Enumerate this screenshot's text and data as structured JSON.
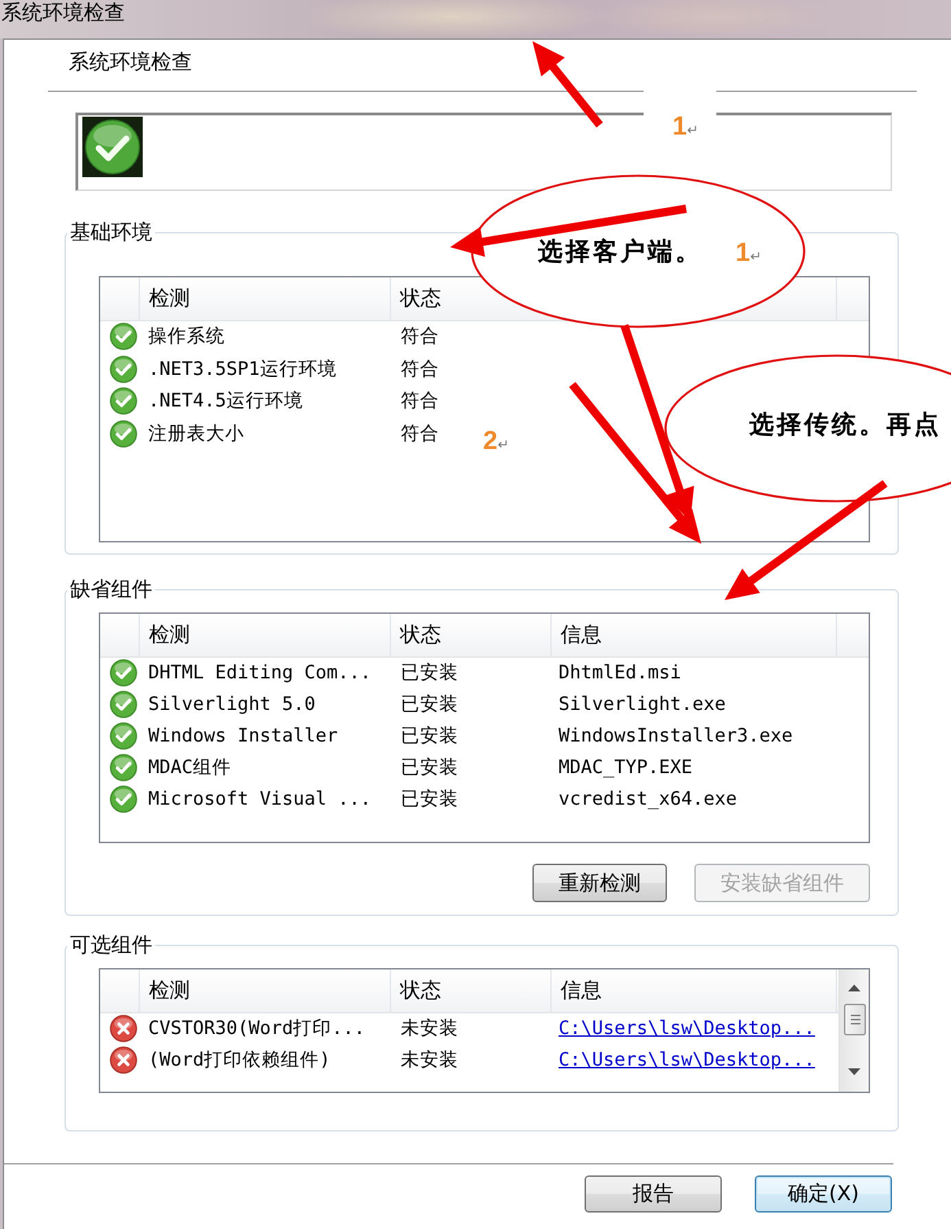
{
  "window": {
    "title": "系统环境检查"
  },
  "header": {
    "title": "系统环境检查"
  },
  "status_box": {
    "passed": true
  },
  "groups": [
    {
      "title": "基础环境",
      "columns": [
        "检测",
        "状态"
      ],
      "rows": [
        {
          "passed": true,
          "check": "操作系统",
          "status": "符合"
        },
        {
          "passed": true,
          "check": ".NET3.5SP1运行环境",
          "status": "符合"
        },
        {
          "passed": true,
          "check": ".NET4.5运行环境",
          "status": "符合"
        },
        {
          "passed": true,
          "check": "注册表大小",
          "status": "符合"
        }
      ]
    },
    {
      "title": "缺省组件",
      "columns": [
        "检测",
        "状态",
        "信息"
      ],
      "rows": [
        {
          "passed": true,
          "check": "DHTML Editing Com...",
          "status": "已安装",
          "info": "DhtmlEd.msi",
          "info_link": false
        },
        {
          "passed": true,
          "check": "Silverlight 5.0",
          "status": "已安装",
          "info": "Silverlight.exe",
          "info_link": false
        },
        {
          "passed": true,
          "check": "Windows Installer",
          "status": "已安装",
          "info": "WindowsInstaller3.exe",
          "info_link": false
        },
        {
          "passed": true,
          "check": "MDAC组件",
          "status": "已安装",
          "info": "MDAC_TYP.EXE",
          "info_link": false
        },
        {
          "passed": true,
          "check": "Microsoft Visual ...",
          "status": "已安装",
          "info": "vcredist_x64.exe",
          "info_link": false
        }
      ],
      "buttons": [
        {
          "label": "重新检测",
          "disabled": false
        },
        {
          "label": "安装缺省组件",
          "disabled": true
        }
      ]
    },
    {
      "title": "可选组件",
      "columns": [
        "检测",
        "状态",
        "信息"
      ],
      "rows": [
        {
          "passed": false,
          "check": "CVSTOR30(Word打印...",
          "status": "未安装",
          "info": "C:\\Users\\lsw\\Desktop...",
          "info_link": true
        },
        {
          "passed": false,
          "check": "(Word打印依赖组件)",
          "status": "未安装",
          "info": "C:\\Users\\lsw\\Desktop...",
          "info_link": true
        }
      ],
      "scrollbar": true
    }
  ],
  "footer_buttons": [
    {
      "label": "报告",
      "default": false
    },
    {
      "label": "确定(X)",
      "default": true
    }
  ],
  "annotations": {
    "callouts": [
      {
        "text": "选择客户端。"
      },
      {
        "text": "选择传统。再点"
      }
    ],
    "step_marks": [
      {
        "number": "1",
        "mark": "↵"
      },
      {
        "number": "1",
        "mark": "↵"
      },
      {
        "number": "2",
        "mark": "↵"
      }
    ]
  }
}
